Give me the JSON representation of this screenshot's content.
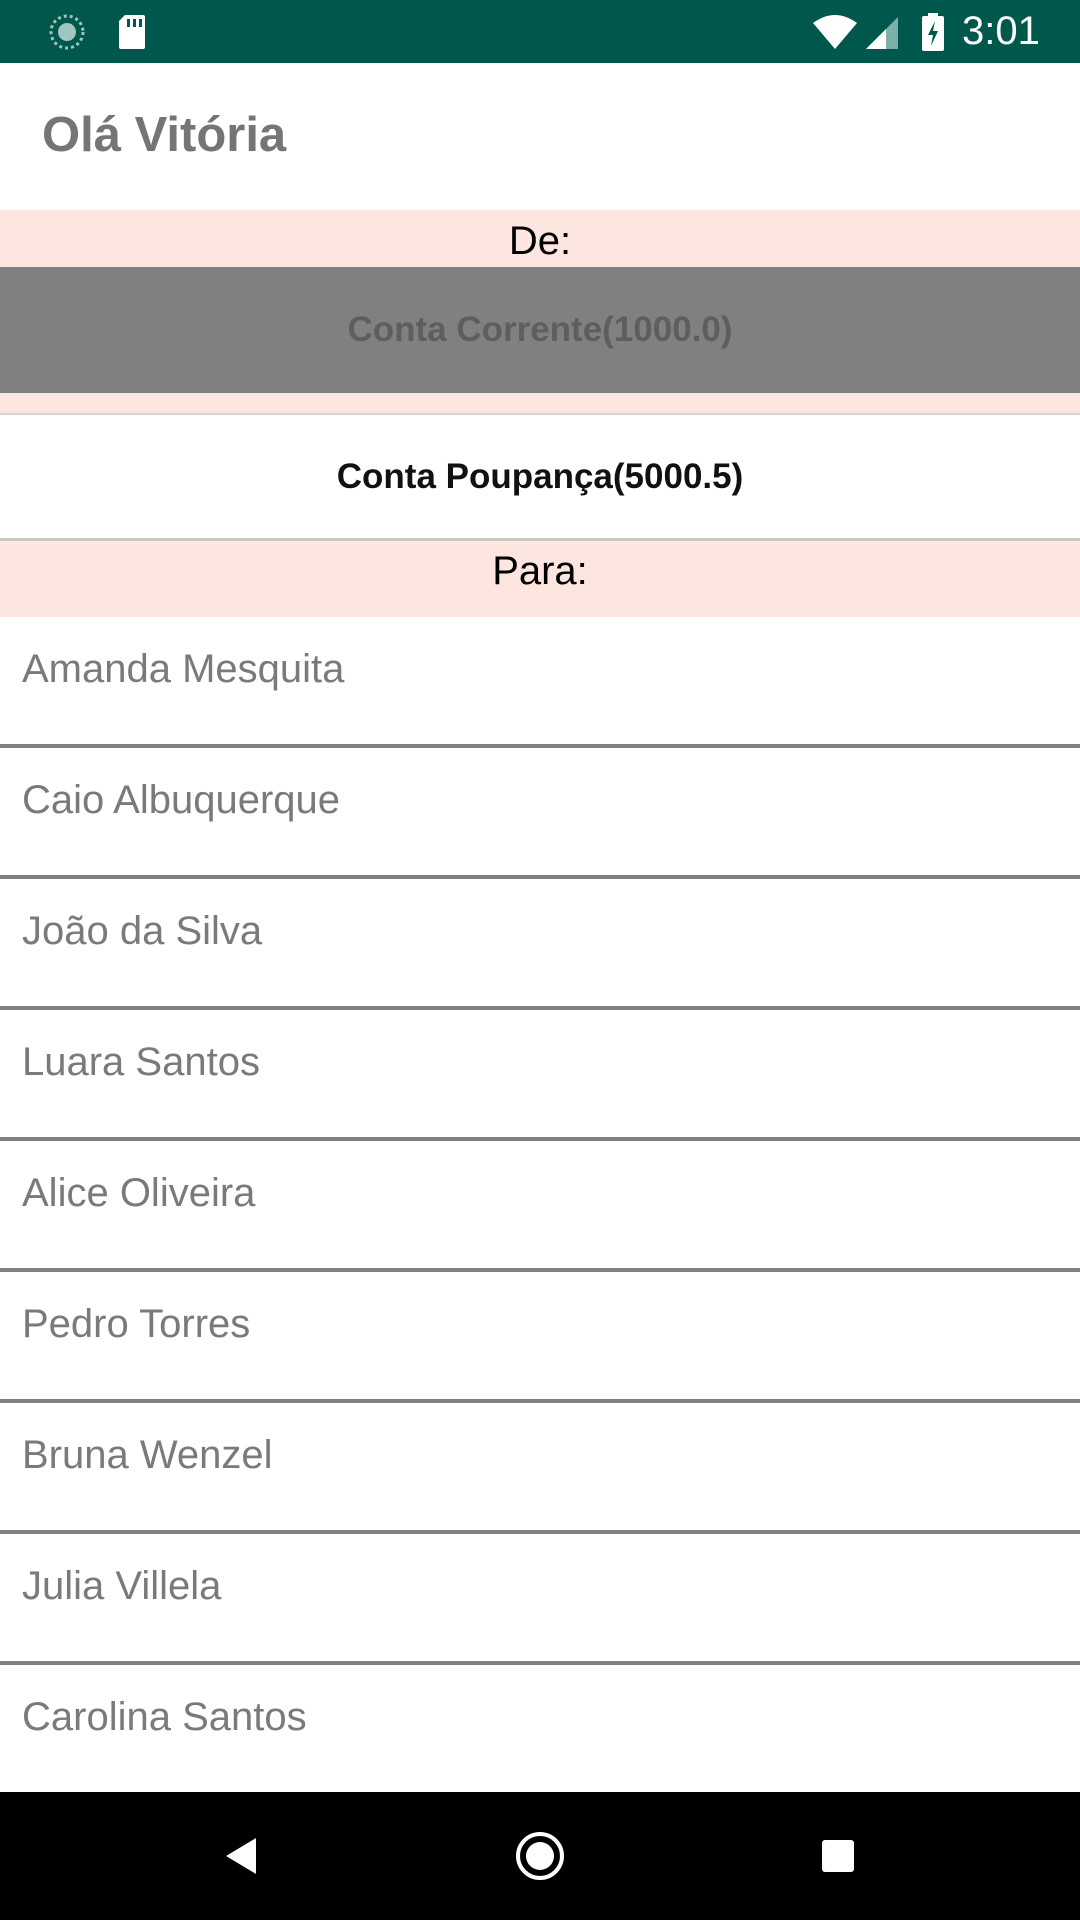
{
  "status_bar": {
    "time": "3:01",
    "icons": [
      "sync-icon",
      "sd-card-icon",
      "wifi-icon",
      "signal-icon",
      "battery-charging-icon"
    ]
  },
  "header": {
    "greeting": "Olá Vitória"
  },
  "transfer": {
    "from_label": "De:",
    "to_label": "Para:",
    "accounts": [
      {
        "label": "Conta Corrente(1000.0)",
        "selected": true
      },
      {
        "label": "Conta Poupança(5000.5)",
        "selected": false
      }
    ]
  },
  "contacts": [
    "Amanda Mesquita",
    "Caio Albuquerque",
    "João da Silva",
    "Luara Santos",
    "Alice Oliveira",
    "Pedro Torres",
    "Bruna Wenzel",
    "Julia Villela",
    "Carolina Santos"
  ],
  "nav_bar": {
    "icons": [
      "back-icon",
      "home-icon",
      "recents-icon"
    ]
  },
  "colors": {
    "status_bar": "#00574b",
    "label_background": "#fde6df",
    "selected_account": "#808080"
  }
}
